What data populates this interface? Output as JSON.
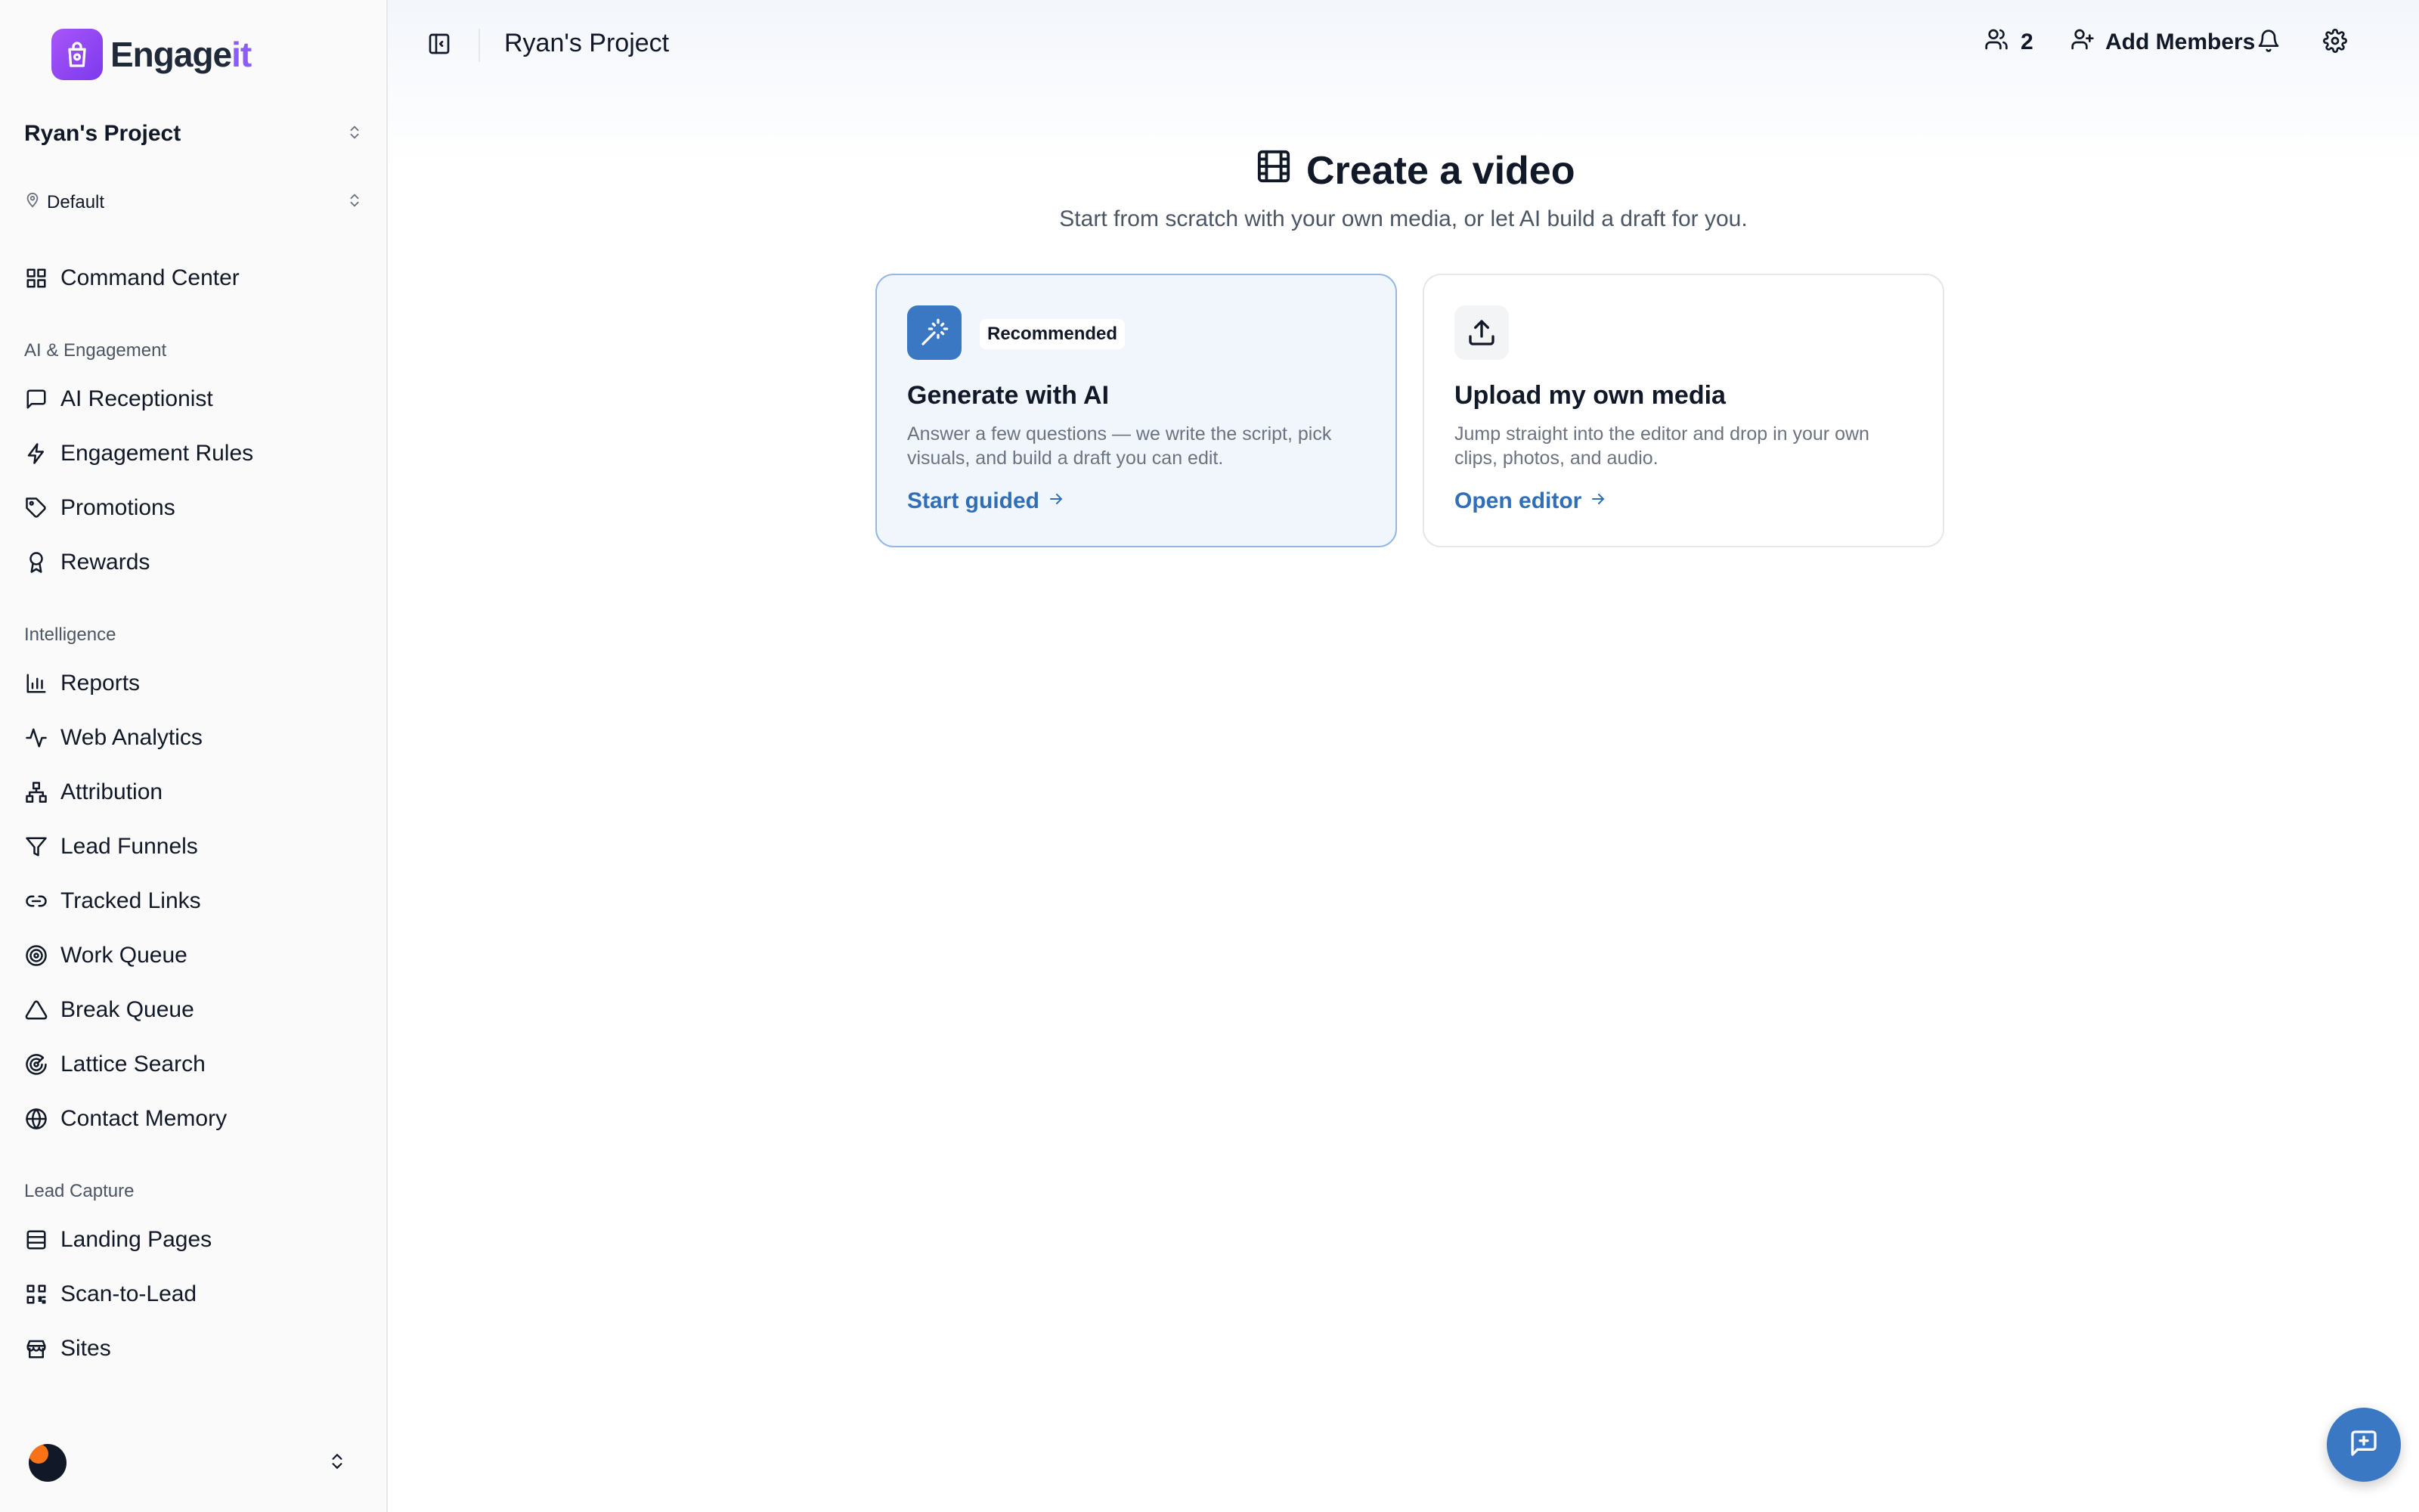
{
  "brand": {
    "logo_main": "Engage",
    "logo_accent": "it",
    "accent_color": "#8b5cf6"
  },
  "sidebar": {
    "project": "Ryan's Project",
    "environment": "Default",
    "top_item": {
      "label": "Command Center",
      "icon": "grid-icon"
    },
    "sections": [
      {
        "label": "AI & Engagement",
        "items": [
          {
            "label": "AI Receptionist",
            "icon": "message-icon"
          },
          {
            "label": "Engagement Rules",
            "icon": "bolt-icon"
          },
          {
            "label": "Promotions",
            "icon": "tag-icon"
          },
          {
            "label": "Rewards",
            "icon": "award-icon"
          }
        ]
      },
      {
        "label": "Intelligence",
        "items": [
          {
            "label": "Reports",
            "icon": "bar-chart-icon"
          },
          {
            "label": "Web Analytics",
            "icon": "activity-icon"
          },
          {
            "label": "Attribution",
            "icon": "network-icon"
          },
          {
            "label": "Lead Funnels",
            "icon": "filter-icon"
          },
          {
            "label": "Tracked Links",
            "icon": "link-icon"
          },
          {
            "label": "Work Queue",
            "icon": "target-icon"
          },
          {
            "label": "Break Queue",
            "icon": "alert-triangle-icon"
          },
          {
            "label": "Lattice Search",
            "icon": "radar-icon"
          },
          {
            "label": "Contact Memory",
            "icon": "globe-icon"
          }
        ]
      },
      {
        "label": "Lead Capture",
        "items": [
          {
            "label": "Landing Pages",
            "icon": "layout-icon"
          },
          {
            "label": "Scan-to-Lead",
            "icon": "qr-code-icon"
          },
          {
            "label": "Sites",
            "icon": "store-icon"
          }
        ]
      }
    ]
  },
  "topbar": {
    "title": "Ryan's Project",
    "member_count": "2",
    "add_members": "Add Members"
  },
  "main": {
    "title": "Create a video",
    "subtitle": "Start from scratch with your own media, or let AI build a draft for you.",
    "cards": [
      {
        "badge": "Recommended",
        "title": "Generate with AI",
        "description": "Answer a few questions — we write the script, pick visuals, and build a draft you can edit.",
        "link": "Start guided",
        "icon": "magic-wand-icon"
      },
      {
        "badge": "",
        "title": "Upload my own media",
        "description": "Jump straight into the editor and drop in your own clips, photos, and audio.",
        "link": "Open editor",
        "icon": "upload-icon"
      }
    ]
  }
}
